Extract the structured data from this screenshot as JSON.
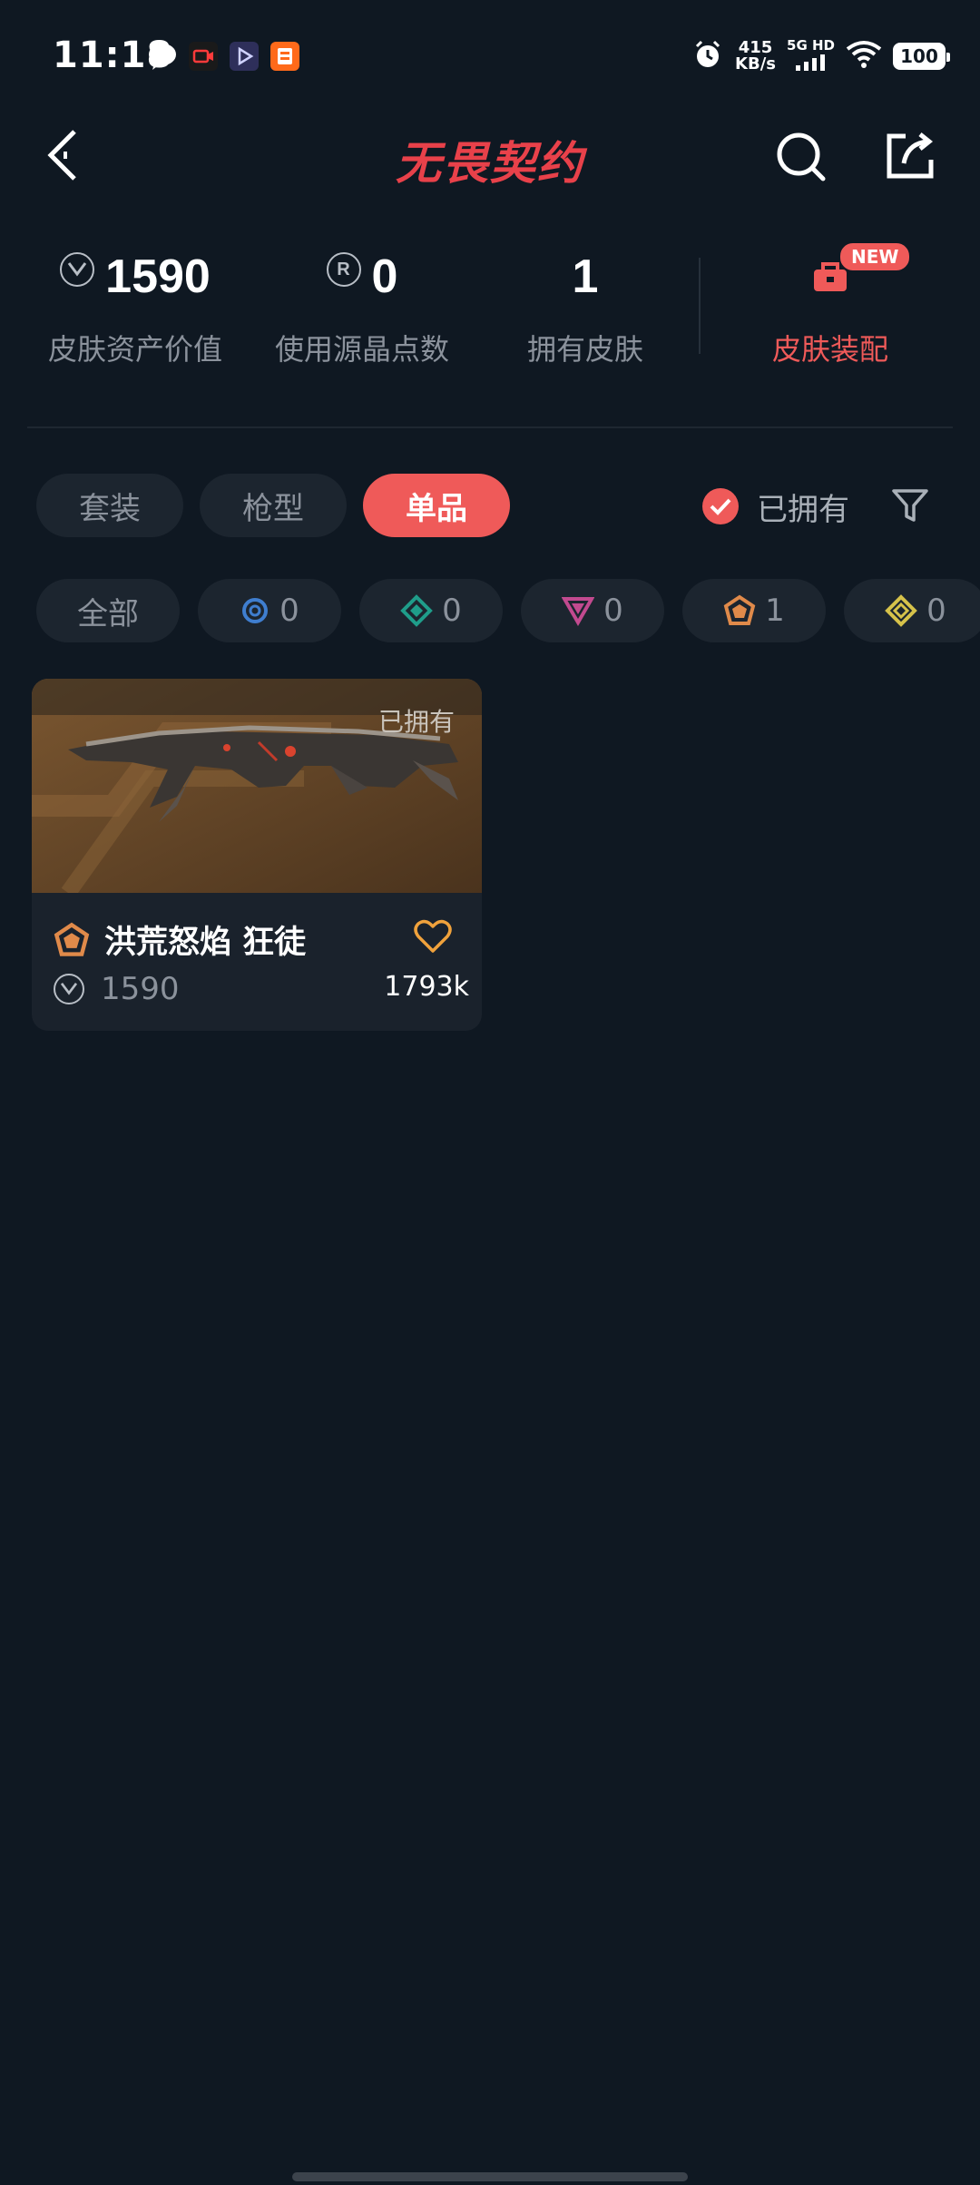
{
  "status_bar": {
    "time": "11:18",
    "net_speed_value": "415",
    "net_speed_unit": "KB/s",
    "network": "5G HD",
    "battery": "100",
    "icons": [
      "chat-icon",
      "record-icon",
      "video-app-icon",
      "taobao-icon",
      "alarm-icon",
      "signal-icon",
      "wifi-icon",
      "battery-icon"
    ]
  },
  "header": {
    "logo_text": "无畏契约",
    "back_icon": "chevron-left-icon",
    "search_icon": "search-icon",
    "share_icon": "share-icon"
  },
  "stats": {
    "asset_value": "1590",
    "asset_label": "皮肤资产价值",
    "radiant_points": "0",
    "radiant_label": "使用源晶点数",
    "owned_skins": "1",
    "owned_label": "拥有皮肤",
    "equip_label": "皮肤装配",
    "equip_badge": "NEW",
    "radiant_icon_letter": "R"
  },
  "tabs": {
    "items": [
      "套装",
      "枪型",
      "单品"
    ],
    "active_index": 2
  },
  "owned_filter": {
    "label": "已拥有",
    "checked": true
  },
  "rarity_chips": [
    {
      "label": "全部"
    },
    {
      "icon": "select-tier-icon",
      "count": "0",
      "color": "#3f7ecf"
    },
    {
      "icon": "deluxe-tier-icon",
      "count": "0",
      "color": "#1f9d8a"
    },
    {
      "icon": "premium-tier-icon",
      "count": "0",
      "color": "#c24a8f"
    },
    {
      "icon": "exclusive-tier-icon",
      "count": "1",
      "color": "#e08a4a"
    },
    {
      "icon": "ultra-tier-icon",
      "count": "0",
      "color": "#d6c24a"
    }
  ],
  "skins": [
    {
      "owned_tag": "已拥有",
      "name": "洪荒怒焰 狂徒",
      "price": "1590",
      "likes": "1793k",
      "tier_icon": "exclusive-tier-icon",
      "favorited": false
    }
  ],
  "colors": {
    "accent": "#ef5a59",
    "background": "#0f1822",
    "surface": "#1c252f"
  }
}
